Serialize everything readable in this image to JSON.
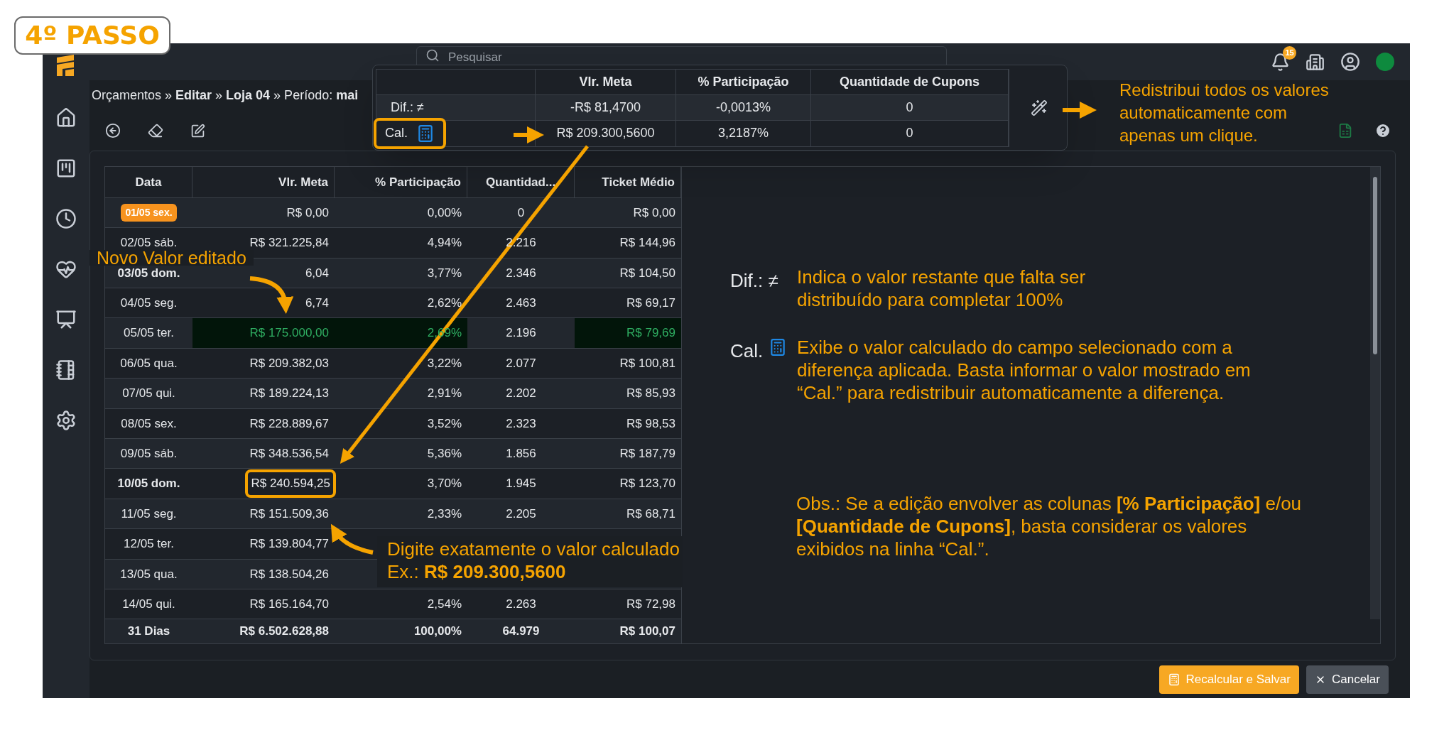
{
  "step_badge": {
    "text": "4º PASSO"
  },
  "topbar": {
    "search_placeholder": "Pesquisar",
    "notification_count": "15",
    "online": true
  },
  "breadcrumb": "Orçamentos » **Editar** » **Loja 04** » Período: **mai**",
  "popup": {
    "columns": [
      "Vlr. Meta",
      "% Participação",
      "Quantidade de Cupons"
    ],
    "rows": [
      {
        "kind": "difference",
        "label": "Dif.: ≠",
        "values": [
          "-R$ 81,4700",
          "-0,0013%",
          "0"
        ],
        "outlined": false
      },
      {
        "kind": "calculated",
        "label": "Cal.",
        "values": [
          "R$ 209.300,5600",
          "3,2187%",
          "0"
        ],
        "outlined": true
      }
    ]
  },
  "table": {
    "columns": [
      "Data",
      "Vlr. Meta",
      "% Participação",
      "Quantidad...",
      "Ticket Médio"
    ],
    "rows": [
      {
        "today": true,
        "bold": false,
        "cells": [
          "01/05 sex.",
          "R$ 0,00",
          "0,00%",
          "0",
          "R$ 0,00"
        ],
        "edited": [
          false,
          false,
          false,
          false,
          false
        ],
        "outlined": false
      },
      {
        "today": false,
        "bold": false,
        "cells": [
          "02/05 sáb.",
          "R$ 321.225,84",
          "4,94%",
          "2.216",
          "R$ 144,96"
        ],
        "edited": [
          false,
          false,
          false,
          false,
          false
        ],
        "outlined": false
      },
      {
        "today": false,
        "bold": true,
        "cells": [
          "03/05 dom.",
          "6,04",
          "3,77%",
          "2.346",
          "R$ 104,50"
        ],
        "edited": [
          false,
          false,
          false,
          false,
          false
        ],
        "outlined": false
      },
      {
        "today": false,
        "bold": false,
        "cells": [
          "04/05 seg.",
          "6,74",
          "2,62%",
          "2.463",
          "R$ 69,17"
        ],
        "edited": [
          false,
          false,
          false,
          false,
          false
        ],
        "outlined": false
      },
      {
        "today": false,
        "bold": false,
        "cells": [
          "05/05 ter.",
          "R$ 175.000,00",
          "2,69%",
          "2.196",
          "R$ 79,69"
        ],
        "edited": [
          false,
          true,
          true,
          false,
          true
        ],
        "outlined": false
      },
      {
        "today": false,
        "bold": false,
        "cells": [
          "06/05 qua.",
          "R$ 209.382,03",
          "3,22%",
          "2.077",
          "R$ 100,81"
        ],
        "edited": [
          false,
          false,
          false,
          false,
          false
        ],
        "outlined": false
      },
      {
        "today": false,
        "bold": false,
        "cells": [
          "07/05 qui.",
          "R$ 189.224,13",
          "2,91%",
          "2.202",
          "R$ 85,93"
        ],
        "edited": [
          false,
          false,
          false,
          false,
          false
        ],
        "outlined": false
      },
      {
        "today": false,
        "bold": false,
        "cells": [
          "08/05 sex.",
          "R$ 228.889,67",
          "3,52%",
          "2.323",
          "R$ 98,53"
        ],
        "edited": [
          false,
          false,
          false,
          false,
          false
        ],
        "outlined": false
      },
      {
        "today": false,
        "bold": false,
        "cells": [
          "09/05 sáb.",
          "R$ 348.536,54",
          "5,36%",
          "1.856",
          "R$ 187,79"
        ],
        "edited": [
          false,
          false,
          false,
          false,
          false
        ],
        "outlined": false
      },
      {
        "today": false,
        "bold": true,
        "cells": [
          "10/05 dom.",
          "R$ 240.594,25",
          "3,70%",
          "1.945",
          "R$ 123,70"
        ],
        "edited": [
          false,
          false,
          false,
          false,
          false
        ],
        "outlined": true
      },
      {
        "today": false,
        "bold": false,
        "cells": [
          "11/05 seg.",
          "R$ 151.509,36",
          "2,33%",
          "2.205",
          "R$ 68,71"
        ],
        "edited": [
          false,
          false,
          false,
          false,
          false
        ],
        "outlined": false
      },
      {
        "today": false,
        "bold": false,
        "cells": [
          "12/05 ter.",
          "R$ 139.804,77"
        ],
        "edited": [
          false,
          false
        ],
        "outlined": false
      },
      {
        "today": false,
        "bold": false,
        "cells": [
          "13/05 qua.",
          "R$ 138.504,26"
        ],
        "edited": [
          false,
          false
        ],
        "outlined": false
      },
      {
        "today": false,
        "bold": false,
        "cells": [
          "14/05 qui.",
          "R$ 165.164,70",
          "2,54%",
          "2.263",
          "R$ 72,98"
        ],
        "edited": [
          false,
          false,
          false,
          false,
          false
        ],
        "outlined": false
      }
    ],
    "footer": [
      "31 Dias",
      "R$ 6.502.628,88",
      "100,00%",
      "64.979",
      "R$ 100,07"
    ]
  },
  "buttons": [
    {
      "kind": "primary",
      "label": "Recalcular e Salvar"
    },
    {
      "kind": "cancel",
      "label": "Cancelar"
    }
  ],
  "annotations": {
    "redistribute": [
      "Redistribui todos os valores",
      "automaticamente com",
      "apenas um clique."
    ],
    "new_value": "Novo Valor editado",
    "type_exactly": [
      "Digite exatamente o valor calculado",
      "Ex.: **R$ 209.300,5600**"
    ],
    "legend": [
      {
        "kind": "difference",
        "label": "Dif.: ≠",
        "lines": [
          "Indica o valor restante que falta ser",
          "distribuído para completar 100%"
        ]
      },
      {
        "kind": "calculated",
        "label": "Cal.",
        "lines": [
          "Exibe o valor calculado do campo selecionado com a",
          "diferença aplicada. Basta informar o valor mostrado em",
          "“Cal.” para redistribuir automaticamente a diferença."
        ]
      }
    ],
    "note": [
      "Obs.: Se a edição envolver as colunas **[% Participação]** e/ou",
      "**[Quantidade de Cupons]**, basta considerar os valores",
      "exibidos na linha “Cal.”."
    ]
  }
}
